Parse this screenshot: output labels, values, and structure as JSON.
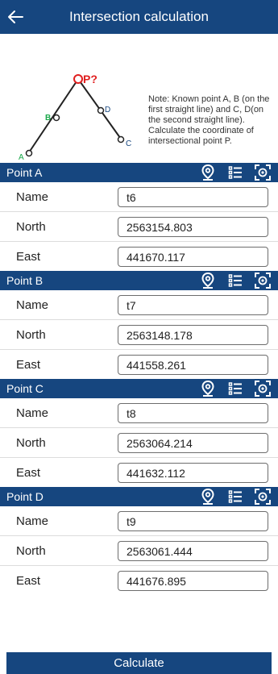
{
  "header": {
    "title": "Intersection calculation",
    "back_icon": "back-arrow-icon"
  },
  "diagram": {
    "labels": {
      "p": "P?",
      "a": "A",
      "b": "B",
      "c": "C",
      "d": "D"
    },
    "colors": {
      "p": "#e02020",
      "b": "#1aa84a",
      "d": "#16467f",
      "c": "#16467f",
      "a": "#1aa84a"
    },
    "note": "Note: Known point A, B (on the first straight line) and C, D(on the second straight line). Calculate the coordinate of intersectional point P."
  },
  "points": [
    {
      "header": "Point A",
      "name_label": "Name",
      "north_label": "North",
      "east_label": "East",
      "name": "t6",
      "north": "2563154.803",
      "east": "441670.117"
    },
    {
      "header": "Point B",
      "name_label": "Name",
      "north_label": "North",
      "east_label": "East",
      "name": "t7",
      "north": "2563148.178",
      "east": "441558.261"
    },
    {
      "header": "Point C",
      "name_label": "Name",
      "north_label": "North",
      "east_label": "East",
      "name": "t8",
      "north": "2563064.214",
      "east": "441632.112"
    },
    {
      "header": "Point D",
      "name_label": "Name",
      "north_label": "North",
      "east_label": "East",
      "name": "t9",
      "north": "2563061.444",
      "east": "441676.895"
    }
  ],
  "header_icons": [
    "location-pin-icon",
    "list-icon",
    "scan-target-icon"
  ],
  "calculate_label": "Calculate",
  "theme": {
    "primary": "#16467f"
  }
}
